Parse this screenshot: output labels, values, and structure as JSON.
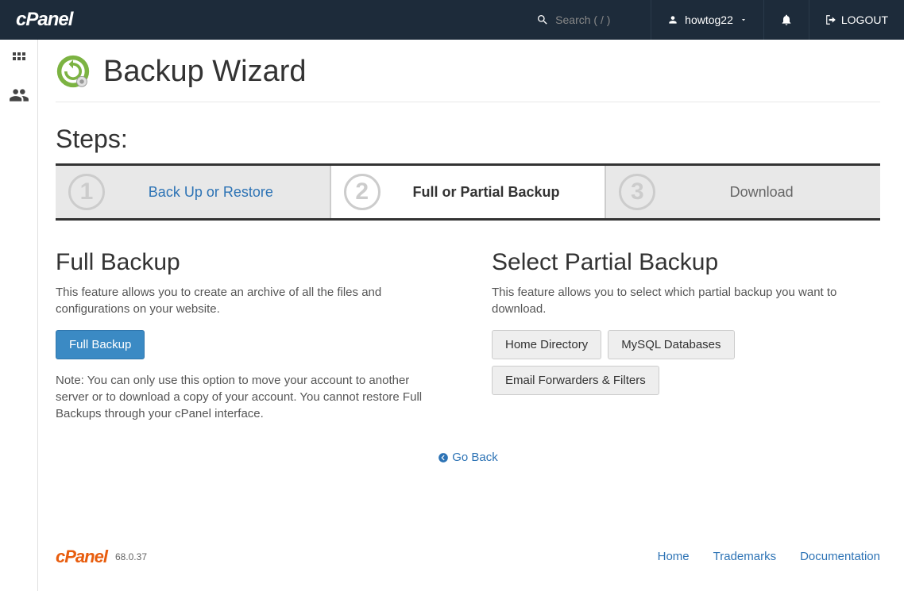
{
  "topbar": {
    "search_placeholder": "Search ( / )",
    "username": "howtog22",
    "logout_label": "LOGOUT"
  },
  "page": {
    "title": "Backup Wizard",
    "steps_label": "Steps:"
  },
  "steps": [
    {
      "num": "1",
      "label": "Back Up or Restore"
    },
    {
      "num": "2",
      "label": "Full or Partial Backup"
    },
    {
      "num": "3",
      "label": "Download"
    }
  ],
  "full_backup": {
    "title": "Full Backup",
    "desc": "This feature allows you to create an archive of all the files and configurations on your website.",
    "button": "Full Backup",
    "note": "Note: You can only use this option to move your account to another server or to download a copy of your account. You cannot restore Full Backups through your cPanel interface."
  },
  "partial_backup": {
    "title": "Select Partial Backup",
    "desc": "This feature allows you to select which partial backup you want to download.",
    "buttons": [
      "Home Directory",
      "MySQL Databases",
      "Email Forwarders & Filters"
    ]
  },
  "go_back_label": "Go Back",
  "footer": {
    "version": "68.0.37",
    "links": [
      "Home",
      "Trademarks",
      "Documentation"
    ]
  }
}
